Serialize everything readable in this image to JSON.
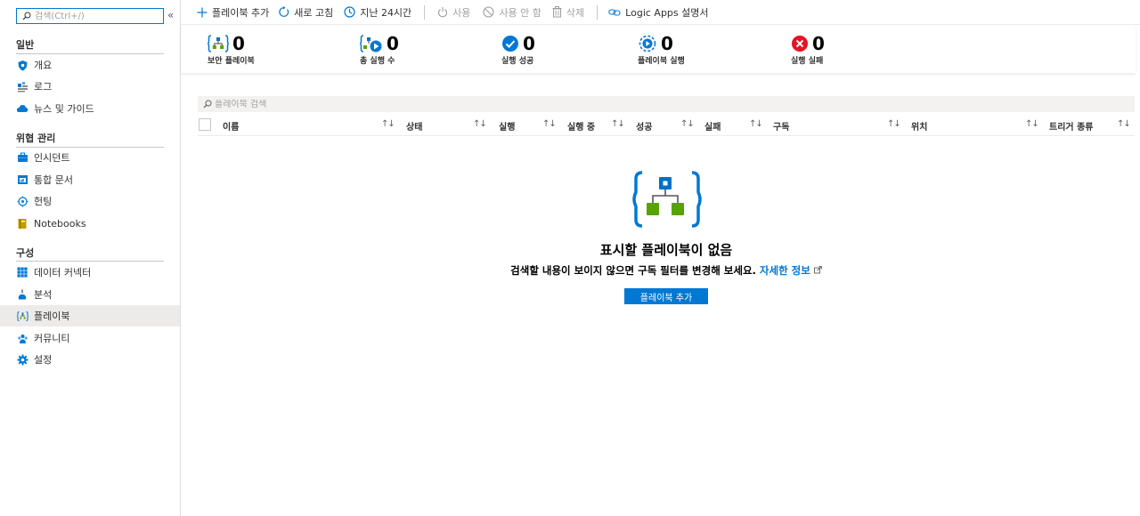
{
  "sidebar": {
    "search_placeholder": "검색(Ctrl+/)",
    "collapse_glyph": "«",
    "sections": [
      {
        "title": "일반",
        "items": [
          {
            "label": "개요",
            "icon": "shield-icon"
          },
          {
            "label": "로그",
            "icon": "logs-icon"
          },
          {
            "label": "뉴스 및 가이드",
            "icon": "cloud-icon"
          }
        ]
      },
      {
        "title": "위협 관리",
        "items": [
          {
            "label": "인시던트",
            "icon": "briefcase-icon"
          },
          {
            "label": "통합 문서",
            "icon": "workbook-icon"
          },
          {
            "label": "헌팅",
            "icon": "target-icon"
          },
          {
            "label": "Notebooks",
            "icon": "notebook-icon"
          }
        ]
      },
      {
        "title": "구성",
        "items": [
          {
            "label": "데이터 커넥터",
            "icon": "grid-icon"
          },
          {
            "label": "분석",
            "icon": "flask-icon"
          },
          {
            "label": "플레이북",
            "icon": "playbook-icon",
            "selected": true
          },
          {
            "label": "커뮤니티",
            "icon": "community-icon"
          },
          {
            "label": "설정",
            "icon": "gear-icon"
          }
        ]
      }
    ]
  },
  "toolbar": {
    "add_playbook": "플레이북 추가",
    "refresh": "새로 고침",
    "time_range": "지난 24시간",
    "enable": "사용",
    "disable": "사용 안 함",
    "delete": "삭제",
    "logic_apps_docs": "Logic Apps 설명서"
  },
  "stats": [
    {
      "value": "0",
      "label": "보안 플레이북",
      "icon": "playbook-stat-icon"
    },
    {
      "value": "0",
      "label": "총 실행 수",
      "icon": "runs-stat-icon"
    },
    {
      "value": "0",
      "label": "실행 성공",
      "icon": "success-check-icon"
    },
    {
      "value": "0",
      "label": "플레이북 실행",
      "icon": "playbook-run-icon"
    },
    {
      "value": "0",
      "label": "실행 실패",
      "icon": "failure-x-icon"
    }
  ],
  "grid": {
    "search_placeholder": "플레이북 검색",
    "columns": [
      "이름",
      "상태",
      "실행",
      "실행 중",
      "성공",
      "실패",
      "구독",
      "위치",
      "트리거 종류"
    ],
    "sort_glyph": "↑↓"
  },
  "empty_state": {
    "title": "표시할 플레이북이 없음",
    "description": "검색할 내용이 보이지 않으면 구독 필터를 변경해 보세요.",
    "learn_more": "자세한 정보",
    "button": "플레이북 추가"
  },
  "colors": {
    "accent": "#0078d4",
    "success": "#0078d4",
    "failure": "#e81123",
    "playbook_green": "#57a300",
    "playbook_blue": "#0072c6"
  }
}
